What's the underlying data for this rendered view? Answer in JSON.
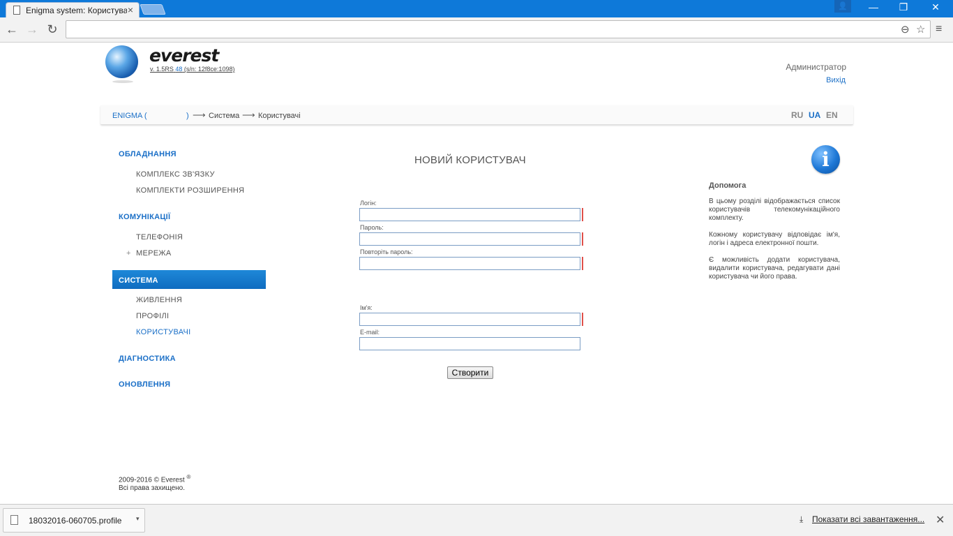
{
  "browser": {
    "tab_title": "Enigma system: Користувачі",
    "tab_close": "×",
    "back": "←",
    "forward": "→",
    "reload": "↻",
    "zoom_icon": "⊖",
    "bookmark_icon": "☆",
    "menu_icon": "≡",
    "win_user": "👤",
    "win_minimize": "—",
    "win_restore": "❐",
    "win_close": "✕"
  },
  "header": {
    "logo_text": "everest",
    "version_prefix": "v. 1.5RS",
    "version_num": "48",
    "version_suffix": "(s/n: 12f8ce:1098)",
    "user": "Администратор",
    "logout": "Вихід"
  },
  "breadcrumb": {
    "root": "ENIGMA (",
    "root_close": ")",
    "arrow": "⟶",
    "level1": "Система",
    "level2": "Користувачі"
  },
  "languages": [
    "RU",
    "UA",
    "EN"
  ],
  "sidebar": {
    "equipment": "ОБЛАДНАННЯ",
    "equipment_items": [
      "КОМПЛЕКС ЗВ'ЯЗКУ",
      "КОМПЛЕКТИ РОЗШИРЕННЯ"
    ],
    "communications": "КОМУНІКАЦІЇ",
    "communications_items": [
      "ТЕЛЕФОНІЯ",
      "МЕРЕЖА"
    ],
    "plus": "+",
    "system": "СИСТЕМА",
    "system_items": [
      "ЖИВЛЕННЯ",
      "ПРОФІЛІ",
      "КОРИСТУВАЧІ"
    ],
    "diagnostics": "ДІАГНОСТИКА",
    "updates": "ОНОВЛЕННЯ"
  },
  "form": {
    "title": "НОВИЙ КОРИСТУВАЧ",
    "login_label": "Логін:",
    "password_label": "Пароль:",
    "repeat_label": "Повторіть пароль:",
    "name_label": "Ім'я:",
    "email_label": "E-mail:",
    "login_value": "",
    "password_value": "",
    "repeat_value": "",
    "name_value": "",
    "email_value": "",
    "submit": "Створити"
  },
  "help": {
    "icon": "i",
    "title": "Допомога",
    "p1": "В цьому розділі відображається список користувачів телекомунікаційного комплекту.",
    "p2": "Кожному користувачу відповідає ім'я, логін і адреса електронної пошти.",
    "p3": "Є можливість додати користувача, видалити користувача, редагувати дані користувача чи його права."
  },
  "footer": {
    "line1": "2009-2016 © Everest",
    "reg": "®",
    "line2": "Всі права захищено."
  },
  "downloads": {
    "file_name": "18032016-060705.profile",
    "dropdown": "▾",
    "show_all": "Показати всі завантаження...",
    "download_icon": "⤓",
    "close": "✕"
  },
  "colors": {
    "accent": "#1a6fc7",
    "titlebar": "#0e79d9",
    "required": "#e0504a"
  }
}
